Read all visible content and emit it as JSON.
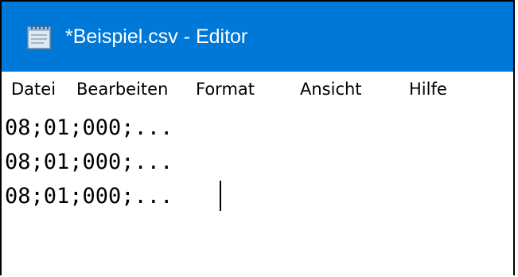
{
  "window": {
    "title": "*Beispiel.csv - Editor",
    "icon": "notepad-icon",
    "title_color": "#0078d7"
  },
  "menu": {
    "items": [
      {
        "label": "Datei"
      },
      {
        "label": "Bearbeiten"
      },
      {
        "label": "Format"
      },
      {
        "label": "Ansicht"
      },
      {
        "label": "Hilfe"
      }
    ]
  },
  "editor": {
    "lines": [
      "08;01;000;...",
      "08;01;000;...",
      "08;01;000;..."
    ]
  }
}
